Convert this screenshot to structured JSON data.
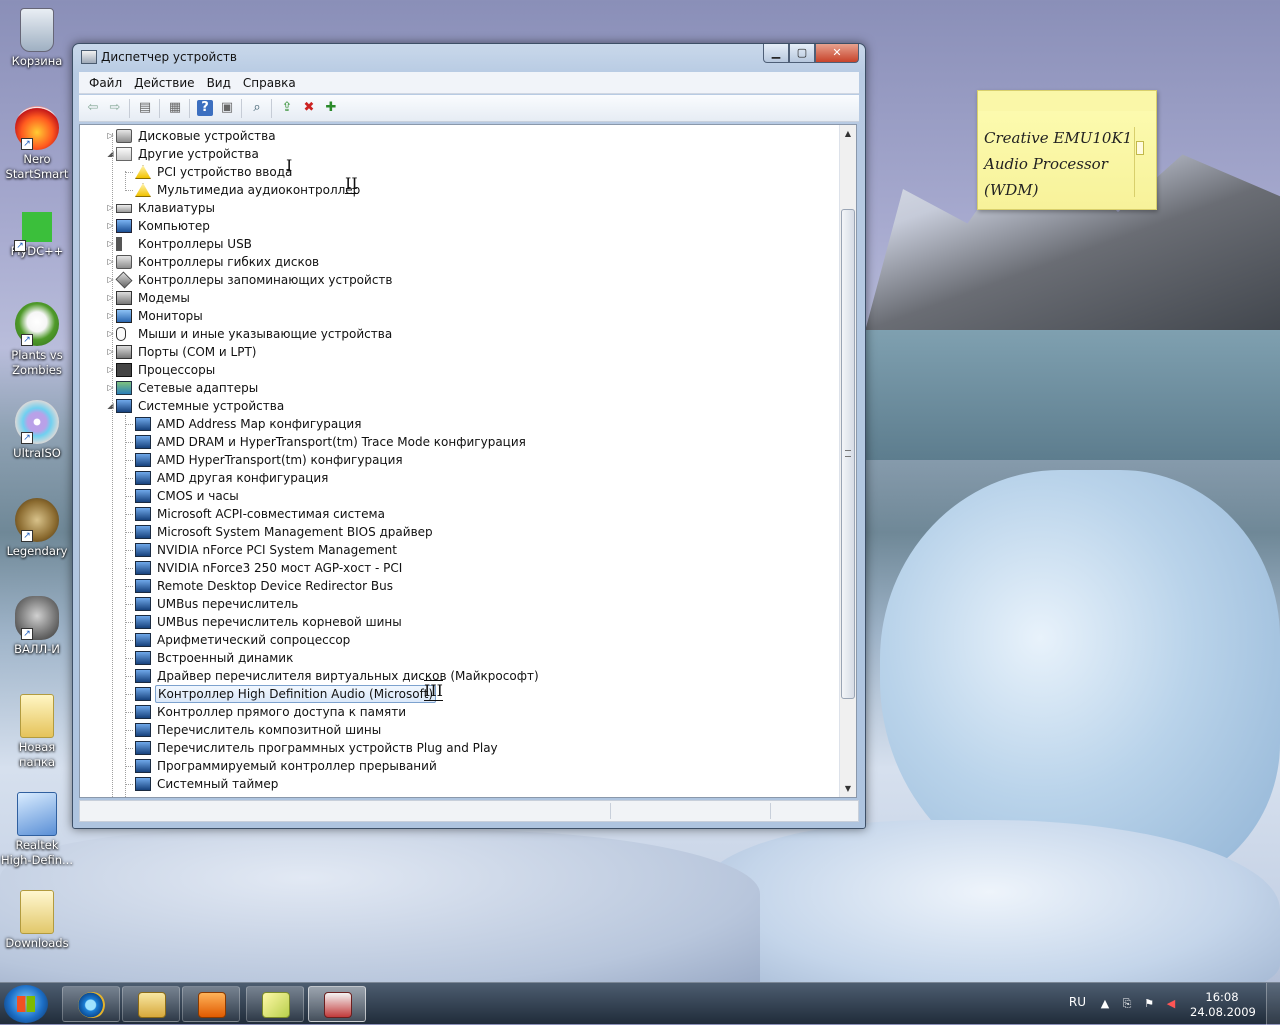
{
  "desktop": {
    "icons": [
      {
        "label": "Корзина",
        "icon": "recycle-bin-icon"
      },
      {
        "label": "Nero StartSmart",
        "icon": "nero-icon"
      },
      {
        "label": "FlyDC++",
        "icon": "flydc-icon"
      },
      {
        "label": "Plants vs Zombies",
        "icon": "plants-vs-zombies-icon"
      },
      {
        "label": "UltraISO",
        "icon": "ultraiso-icon"
      },
      {
        "label": "Legendary",
        "icon": "legendary-icon"
      },
      {
        "label": "ВАЛЛ-И",
        "icon": "wall-e-icon"
      },
      {
        "label": "Новая папка",
        "icon": "folder-icon"
      },
      {
        "label": "Realtek High-Defin...",
        "icon": "realtek-icon"
      },
      {
        "label": "Downloads",
        "icon": "folder-icon"
      }
    ]
  },
  "window": {
    "title": "Диспетчер устройств",
    "buttons": {
      "minimize": "▁",
      "maximize": "▢",
      "close": "✕"
    },
    "menu": [
      "Файл",
      "Действие",
      "Вид",
      "Справка"
    ],
    "toolbar_icons": [
      "back-arrow-icon",
      "forward-arrow-icon",
      "show-hide-console-tree-icon",
      "properties-icon",
      "help-icon",
      "action-pane-icon",
      "scan-hardware-icon",
      "update-driver-icon",
      "uninstall-icon",
      "enable-device-icon"
    ]
  },
  "tree": [
    {
      "label": "Дисковые устройства",
      "level": 0,
      "expander": "▷",
      "icon": "disk"
    },
    {
      "label": "Другие устройства",
      "level": 0,
      "expander": "◢",
      "icon": "unk"
    },
    {
      "label": "PCI устройство ввода",
      "level": 1,
      "expander": "",
      "icon": "warn"
    },
    {
      "label": "Мультимедиа аудиоконтроллер",
      "level": 1,
      "expander": "",
      "icon": "warn"
    },
    {
      "label": "Клавиатуры",
      "level": 0,
      "expander": "▷",
      "icon": "kbd"
    },
    {
      "label": "Компьютер",
      "level": 0,
      "expander": "▷",
      "icon": "comp"
    },
    {
      "label": "Контроллеры USB",
      "level": 0,
      "expander": "▷",
      "icon": "usb"
    },
    {
      "label": "Контроллеры гибких дисков",
      "level": 0,
      "expander": "▷",
      "icon": "disk"
    },
    {
      "label": "Контроллеры запоминающих устройств",
      "level": 0,
      "expander": "▷",
      "icon": "storage"
    },
    {
      "label": "Модемы",
      "level": 0,
      "expander": "▷",
      "icon": "port"
    },
    {
      "label": "Мониторы",
      "level": 0,
      "expander": "▷",
      "icon": "mon"
    },
    {
      "label": "Мыши и иные указывающие устройства",
      "level": 0,
      "expander": "▷",
      "icon": "mouse"
    },
    {
      "label": "Порты (COM и LPT)",
      "level": 0,
      "expander": "▷",
      "icon": "port"
    },
    {
      "label": "Процессоры",
      "level": 0,
      "expander": "▷",
      "icon": "chip"
    },
    {
      "label": "Сетевые адаптеры",
      "level": 0,
      "expander": "▷",
      "icon": "net"
    },
    {
      "label": "Системные устройства",
      "level": 0,
      "expander": "◢",
      "icon": "sys"
    },
    {
      "label": "AMD Address Map конфигурация",
      "level": 1,
      "expander": "",
      "icon": "sys"
    },
    {
      "label": "AMD DRAM и HyperTransport(tm) Trace Mode конфигурация",
      "level": 1,
      "expander": "",
      "icon": "sys"
    },
    {
      "label": "AMD HyperTransport(tm) конфигурация",
      "level": 1,
      "expander": "",
      "icon": "sys"
    },
    {
      "label": "AMD другая конфигурация",
      "level": 1,
      "expander": "",
      "icon": "sys"
    },
    {
      "label": "CMOS и часы",
      "level": 1,
      "expander": "",
      "icon": "sys"
    },
    {
      "label": "Microsoft ACPI-совместимая система",
      "level": 1,
      "expander": "",
      "icon": "sys"
    },
    {
      "label": "Microsoft System Management BIOS драйвер",
      "level": 1,
      "expander": "",
      "icon": "sys"
    },
    {
      "label": "NVIDIA nForce PCI System Management",
      "level": 1,
      "expander": "",
      "icon": "sys"
    },
    {
      "label": "NVIDIA nForce3 250 мост AGP-хост - PCI",
      "level": 1,
      "expander": "",
      "icon": "sys"
    },
    {
      "label": "Remote Desktop Device Redirector Bus",
      "level": 1,
      "expander": "",
      "icon": "sys"
    },
    {
      "label": "UMBus перечислитель",
      "level": 1,
      "expander": "",
      "icon": "sys"
    },
    {
      "label": "UMBus перечислитель корневой шины",
      "level": 1,
      "expander": "",
      "icon": "sys"
    },
    {
      "label": "Арифметический сопроцессор",
      "level": 1,
      "expander": "",
      "icon": "sys"
    },
    {
      "label": "Встроенный динамик",
      "level": 1,
      "expander": "",
      "icon": "sys"
    },
    {
      "label": "Драйвер перечислителя виртуальных дисков (Майкрософт)",
      "level": 1,
      "expander": "",
      "icon": "sys"
    },
    {
      "label": "Контроллер High Definition Audio (Microsoft)",
      "level": 1,
      "expander": "",
      "icon": "sys",
      "selected": true
    },
    {
      "label": "Контроллер прямого доступа к памяти",
      "level": 1,
      "expander": "",
      "icon": "sys"
    },
    {
      "label": "Перечислитель композитной шины",
      "level": 1,
      "expander": "",
      "icon": "sys"
    },
    {
      "label": "Перечислитель программных устройств Plug and Play",
      "level": 1,
      "expander": "",
      "icon": "sys"
    },
    {
      "label": "Программируемый контроллер прерываний",
      "level": 1,
      "expander": "",
      "icon": "sys"
    },
    {
      "label": "Системный таймер",
      "level": 1,
      "expander": "",
      "icon": "sys"
    }
  ],
  "annotations": {
    "mark1": "I",
    "mark2": "II",
    "mark3": "III"
  },
  "sticky_note": {
    "text": "Creative EMU10K1 Audio Processor (WDM)"
  },
  "taskbar": {
    "pinned": [
      "internet-explorer-icon",
      "windows-explorer-icon",
      "media-player-icon",
      "sticky-notes-icon",
      "device-manager-icon"
    ],
    "language": "RU",
    "time": "16:08",
    "date": "24.08.2009"
  }
}
